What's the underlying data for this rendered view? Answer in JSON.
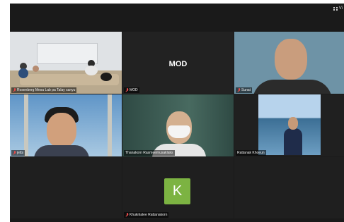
{
  "toolbar": {
    "view_label": "Vi",
    "view_icon": "grid-view-icon"
  },
  "participants": [
    {
      "name": "Rosenberg  Mesa Lab  pa  Talay sanyu",
      "muted": true,
      "active": true,
      "video": true
    },
    {
      "name": "MOD",
      "display_text": "MOD",
      "muted": true,
      "video": false
    },
    {
      "name": "Sunat",
      "muted": true,
      "video": true
    },
    {
      "name": "jetts",
      "muted": true,
      "video": true
    },
    {
      "name": "Thanakorn Rasmeemusaklaks",
      "muted": false,
      "video": true
    },
    {
      "name": "Rattanak Khoeun",
      "muted": false,
      "video": true
    },
    {
      "name": "Khuknlalee Rattanakorn",
      "avatar_letter": "K",
      "muted": true,
      "video": false
    }
  ],
  "colors": {
    "background": "#1a1a1a",
    "active_speaker_border": "#d6e35a",
    "avatar_green": "#7cb342",
    "muted_red": "#e34b4b"
  }
}
